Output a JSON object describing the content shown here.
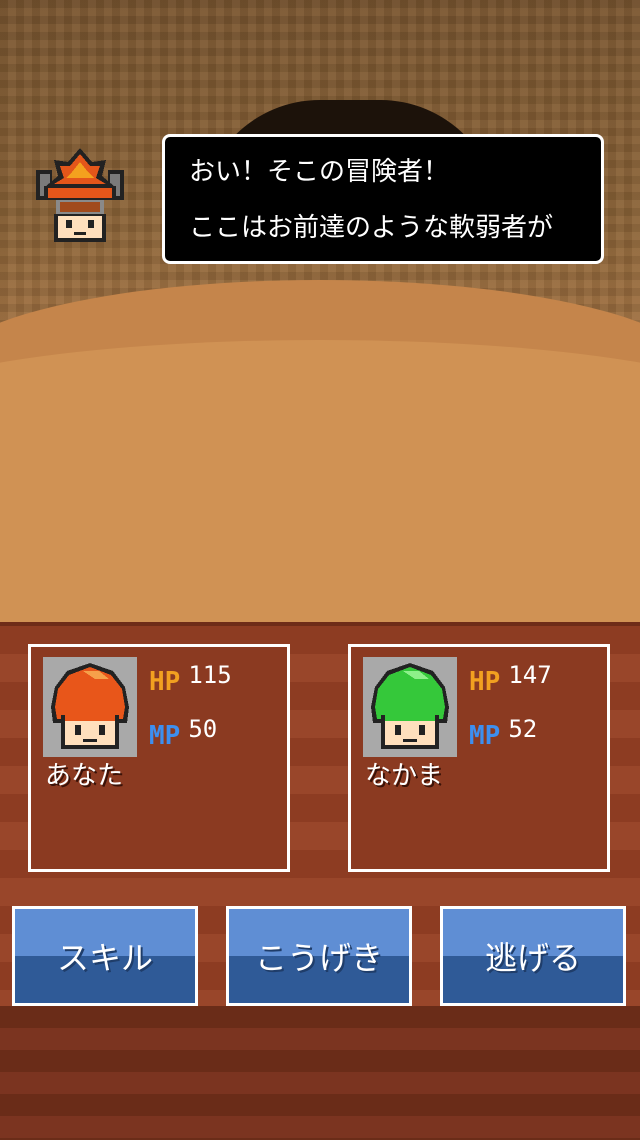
{
  "dialog": {
    "line1": "おい！そこの冒険者！",
    "line2": "ここはお前達のような軟弱者が"
  },
  "party": [
    {
      "name": "あなた",
      "hp_label": "HP",
      "hp": "115",
      "mp_label": "MP",
      "mp": "50",
      "hair_color": "#e8561a"
    },
    {
      "name": "なかま",
      "hp_label": "HP",
      "hp": "147",
      "mp_label": "MP",
      "mp": "52",
      "hair_color": "#35c83a"
    }
  ],
  "commands": {
    "skill": "スキル",
    "attack": "こうげき",
    "flee": "逃げる"
  },
  "colors": {
    "hp_label": "#f2a020",
    "mp_label": "#3d8ff0",
    "button_top": "#5f8ed4",
    "button_bottom": "#2f5a97"
  }
}
